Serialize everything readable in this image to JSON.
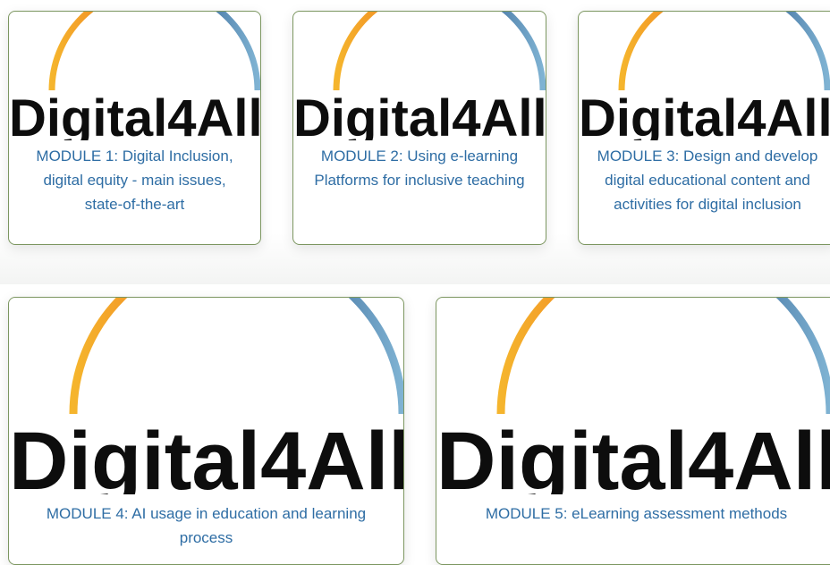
{
  "brand": {
    "logo_text": "Digital4All",
    "arc_colors": [
      "#f5b52d",
      "#f07e22",
      "#2f5c8f",
      "#7fb3d3"
    ]
  },
  "modules": [
    {
      "title": "MODULE 1: Digital Inclusion, digital equity - main issues, state-of-the-art"
    },
    {
      "title": "MODULE 2: Using e-learning Platforms for inclusive teaching"
    },
    {
      "title": "MODULE 3: Design and develop digital educational content and activities for digital inclusion"
    },
    {
      "title": "MODULE 4: AI usage in education and learning process"
    },
    {
      "title": "MODULE 5: eLearning assessment methods"
    }
  ]
}
